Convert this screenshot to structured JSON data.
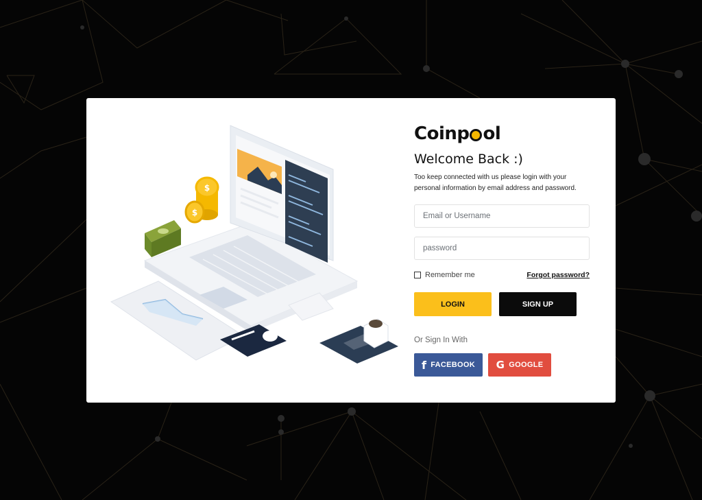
{
  "brand": {
    "name_part1": "Coinp",
    "name_part2": "ol",
    "coin_color": "#f5b800"
  },
  "form": {
    "title": "Welcome Back :)",
    "subtitle": "Too keep connected with us please login with your personal information by email address and password.",
    "email_placeholder": "Email or Username",
    "password_placeholder": "password",
    "remember_label": "Remember me",
    "forgot_label": "Forgot password?",
    "login_label": "LOGIN",
    "signup_label": "SIGN UP",
    "or_text": "Or Sign In With",
    "facebook_label": "FACEBOOK",
    "facebook_icon": "f",
    "google_label": "GOOGLE",
    "google_icon": "G"
  },
  "colors": {
    "login": "#fbbf1b",
    "signup": "#0b0b0b",
    "facebook": "#3b5998",
    "google": "#e14d3f",
    "background": "#050505"
  }
}
